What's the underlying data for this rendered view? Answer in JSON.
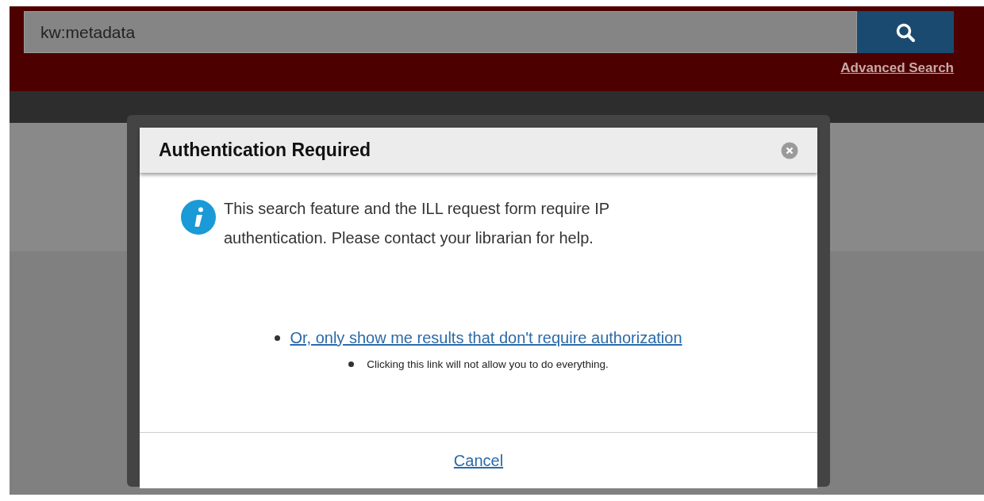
{
  "search": {
    "value": "kw:metadata",
    "advanced_link": "Advanced Search"
  },
  "dialog": {
    "title": "Authentication Required",
    "message": "This search feature and the ILL request form require IP authentication. Please contact your librarian for help.",
    "options": [
      {
        "kind": "link",
        "text": "Or, only show me results that don't require authorization"
      },
      {
        "kind": "note",
        "text": "Clicking this link will not allow you to do everything."
      }
    ],
    "cancel": "Cancel"
  }
}
